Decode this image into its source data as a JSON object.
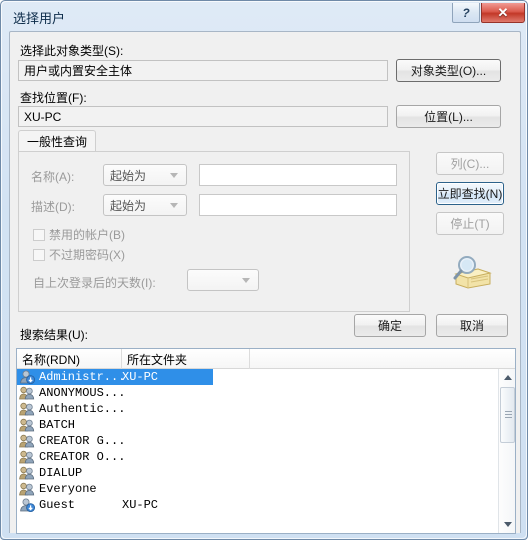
{
  "window": {
    "title": "选择用户",
    "help_button": "?",
    "close_button": "✕"
  },
  "object_type": {
    "label": "选择此对象类型(S):",
    "value": "用户或内置安全主体",
    "button": "对象类型(O)..."
  },
  "location": {
    "label": "查找位置(F):",
    "value": "XU-PC",
    "button": "位置(L)..."
  },
  "query_tab": {
    "label": "一般性查询",
    "name_label": "名称(A):",
    "name_condition": "起始为",
    "name_value": "",
    "name_placeholder": "",
    "desc_label": "描述(D):",
    "desc_condition": "起始为",
    "desc_value": "",
    "desc_placeholder": "",
    "disabled_accounts_label": "禁用的帐户(B)",
    "non_expiring_password_label": "不过期密码(X)",
    "days_since_logon_label": "自上次登录后的天数(I):",
    "days_since_logon_value": ""
  },
  "side_buttons": {
    "columns": "列(C)...",
    "find_now": "立即查找(N)",
    "stop": "停止(T)",
    "search_icon": "magnifier-folder-icon"
  },
  "dialog_buttons": {
    "ok": "确定",
    "cancel": "取消"
  },
  "results": {
    "label": "搜索结果(U):",
    "columns": [
      "名称(RDN)",
      "所在文件夹"
    ],
    "rows": [
      {
        "name": "Administr...",
        "folder": "XU-PC",
        "icon": "user-icon",
        "selected": true
      },
      {
        "name": "ANONYMOUS...",
        "folder": "",
        "icon": "group-icon",
        "selected": false
      },
      {
        "name": "Authentic...",
        "folder": "",
        "icon": "group-icon",
        "selected": false
      },
      {
        "name": "BATCH",
        "folder": "",
        "icon": "group-icon",
        "selected": false
      },
      {
        "name": "CREATOR G...",
        "folder": "",
        "icon": "group-icon",
        "selected": false
      },
      {
        "name": "CREATOR O...",
        "folder": "",
        "icon": "group-icon",
        "selected": false
      },
      {
        "name": "DIALUP",
        "folder": "",
        "icon": "group-icon",
        "selected": false
      },
      {
        "name": "Everyone",
        "folder": "",
        "icon": "group-icon",
        "selected": false
      },
      {
        "name": "Guest",
        "folder": "XU-PC",
        "icon": "user-icon",
        "selected": false
      }
    ]
  },
  "colors": {
    "selection": "#2f8fe8",
    "title_text": "#0b2a48",
    "close_button": "#c23828",
    "default_button_border": "#2c628b"
  }
}
